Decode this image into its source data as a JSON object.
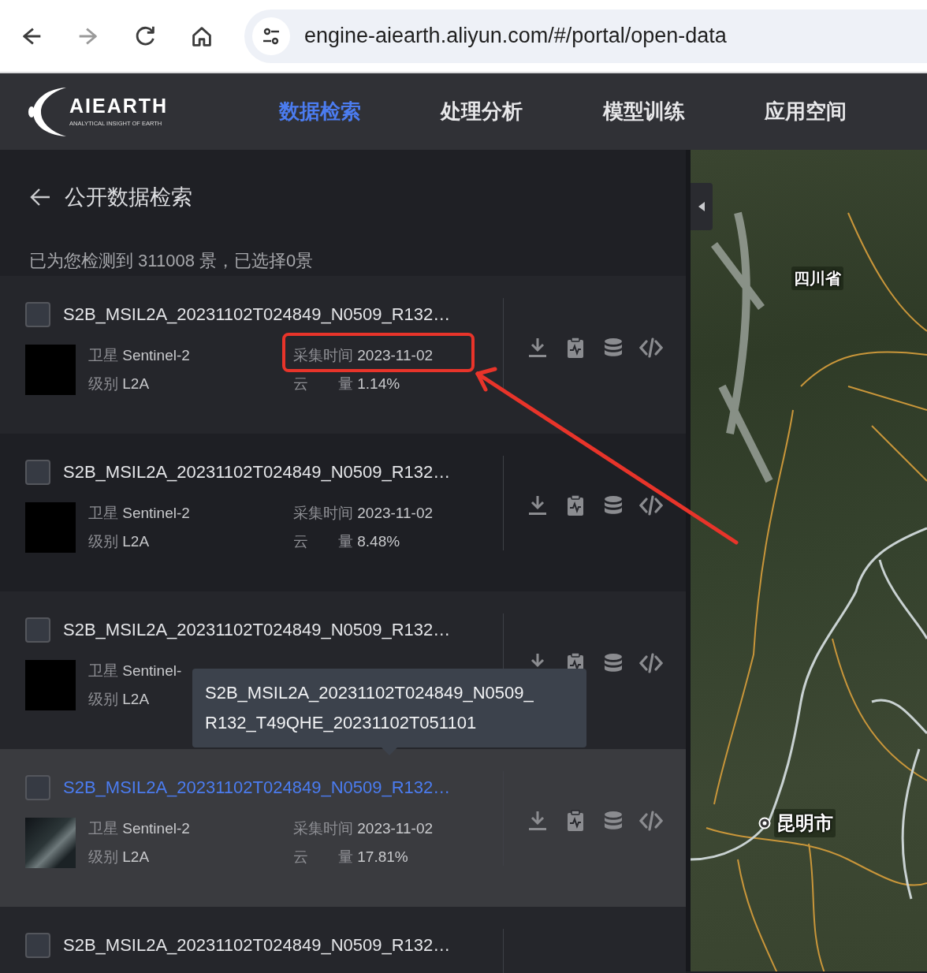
{
  "browser": {
    "nav_buttons": [
      {
        "kind": "back",
        "disabled": false
      },
      {
        "kind": "forward",
        "disabled": true
      },
      {
        "kind": "reload",
        "disabled": false
      },
      {
        "kind": "home",
        "disabled": false
      }
    ],
    "url": "engine-aiearth.aliyun.com/#/portal/open-data"
  },
  "header": {
    "logo": {
      "name": "AIEARTH",
      "tagline": "ANALYTICAL INSIGHT OF EARTH"
    },
    "tabs": [
      {
        "label": "数据检索",
        "selected": true
      },
      {
        "label": "处理分析",
        "selected": false
      },
      {
        "label": "模型训练",
        "selected": false
      },
      {
        "label": "应用空间",
        "selected": false
      }
    ]
  },
  "panel": {
    "title": "公开数据检索",
    "summary": "已为您检测到 311008 景，已选择0景",
    "items": [
      {
        "title": "S2B_MSIL2A_20231102T024849_N0509_R132…",
        "checked": false,
        "hovered": false,
        "details": {
          "satellite": {
            "label": "卫星",
            "value": "Sentinel-2"
          },
          "capture_time": {
            "label": "采集时间",
            "value": "2023-11-02"
          },
          "level": {
            "label": "级别",
            "value": "L2A"
          },
          "cloud": {
            "label": "云　　量",
            "value": "1.14%"
          }
        }
      },
      {
        "title": "S2B_MSIL2A_20231102T024849_N0509_R132…",
        "checked": false,
        "hovered": false,
        "details": {
          "satellite": {
            "label": "卫星",
            "value": "Sentinel-2"
          },
          "capture_time": {
            "label": "采集时间",
            "value": "2023-11-02"
          },
          "level": {
            "label": "级别",
            "value": "L2A"
          },
          "cloud": {
            "label": "云　　量",
            "value": "8.48%"
          }
        }
      },
      {
        "title": "S2B_MSIL2A_20231102T024849_N0509_R132…",
        "checked": false,
        "hovered": false,
        "details": {
          "satellite": {
            "label": "卫星",
            "value": "Sentinel-"
          },
          "level": {
            "label": "级别",
            "value": "L2A"
          }
        }
      },
      {
        "title": "S2B_MSIL2A_20231102T024849_N0509_R132…",
        "checked": false,
        "hovered": true,
        "details": {
          "satellite": {
            "label": "卫星",
            "value": "Sentinel-2"
          },
          "capture_time": {
            "label": "采集时间",
            "value": "2023-11-02"
          },
          "level": {
            "label": "级别",
            "value": "L2A"
          },
          "cloud": {
            "label": "云　　量",
            "value": "17.81%"
          }
        }
      },
      {
        "title": "S2B_MSIL2A_20231102T024849_N0509_R132…",
        "checked": false,
        "hovered": false
      }
    ],
    "tooltip": {
      "text": "S2B_MSIL2A_20231102T024849_N0509_R132_T49QHE_20231102T051101"
    }
  },
  "map": {
    "labels": [
      {
        "text": "四川省",
        "kind": "region"
      },
      {
        "text": "昆明市",
        "kind": "city"
      }
    ]
  }
}
